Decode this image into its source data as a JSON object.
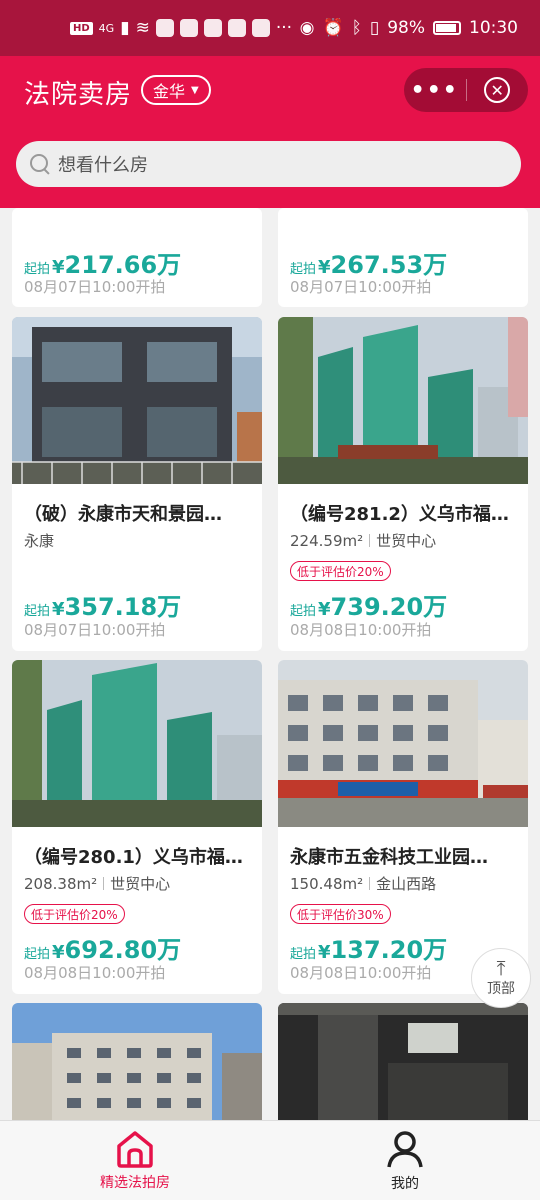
{
  "status_bar": {
    "badge": "HD",
    "network": "4G",
    "battery": "98%",
    "time": "10:30",
    "icons": [
      "signal-icon",
      "wifi-icon",
      "app-icon",
      "app-icon",
      "app-icon",
      "app-icon",
      "app-icon",
      "more-dots-icon",
      "eye-icon",
      "alarm-icon",
      "bluetooth-icon",
      "vibrate-icon",
      "battery-icon"
    ]
  },
  "header": {
    "title": "法院卖房",
    "city": "金华",
    "more_icon": "more-dots-icon",
    "close_icon": "close-circle-icon"
  },
  "search": {
    "placeholder": "想看什么房"
  },
  "listings": [
    {
      "title": "",
      "area": "",
      "location": "",
      "tag": "",
      "start_label": "起拍",
      "currency": "¥",
      "price": "217.66万",
      "date": "08月07日10:00开拍"
    },
    {
      "title": "",
      "area": "",
      "location": "",
      "tag": "",
      "start_label": "起拍",
      "currency": "¥",
      "price": "267.53万",
      "date": "08月07日10:00开拍"
    },
    {
      "title": "（破）永康市天和景园…",
      "area": "",
      "location": "永康",
      "tag": "",
      "start_label": "起拍",
      "currency": "¥",
      "price": "357.18万",
      "date": "08月07日10:00开拍"
    },
    {
      "title": "（编号281.2）义乌市福…",
      "area": "224.59m²",
      "location": "世贸中心",
      "tag": "低于评估价20%",
      "start_label": "起拍",
      "currency": "¥",
      "price": "739.20万",
      "date": "08月08日10:00开拍"
    },
    {
      "title": "（编号280.1）义乌市福…",
      "area": "208.38m²",
      "location": "世贸中心",
      "tag": "低于评估价20%",
      "start_label": "起拍",
      "currency": "¥",
      "price": "692.80万",
      "date": "08月08日10:00开拍"
    },
    {
      "title": "永康市五金科技工业园…",
      "area": "150.48m²",
      "location": "金山西路",
      "tag": "低于评估价30%",
      "start_label": "起拍",
      "currency": "¥",
      "price": "137.20万",
      "date": "08月08日10:00开拍"
    }
  ],
  "back_to_top": {
    "label": "顶部",
    "icon": "arrow-up-icon"
  },
  "tabbar": {
    "items": [
      {
        "label": "精选法拍房",
        "icon": "home-icon",
        "active": true
      },
      {
        "label": "我的",
        "icon": "user-icon",
        "active": false
      }
    ]
  },
  "colors": {
    "primary": "#e6124a",
    "price": "#1aa89a",
    "statusbar": "#a8153c"
  }
}
